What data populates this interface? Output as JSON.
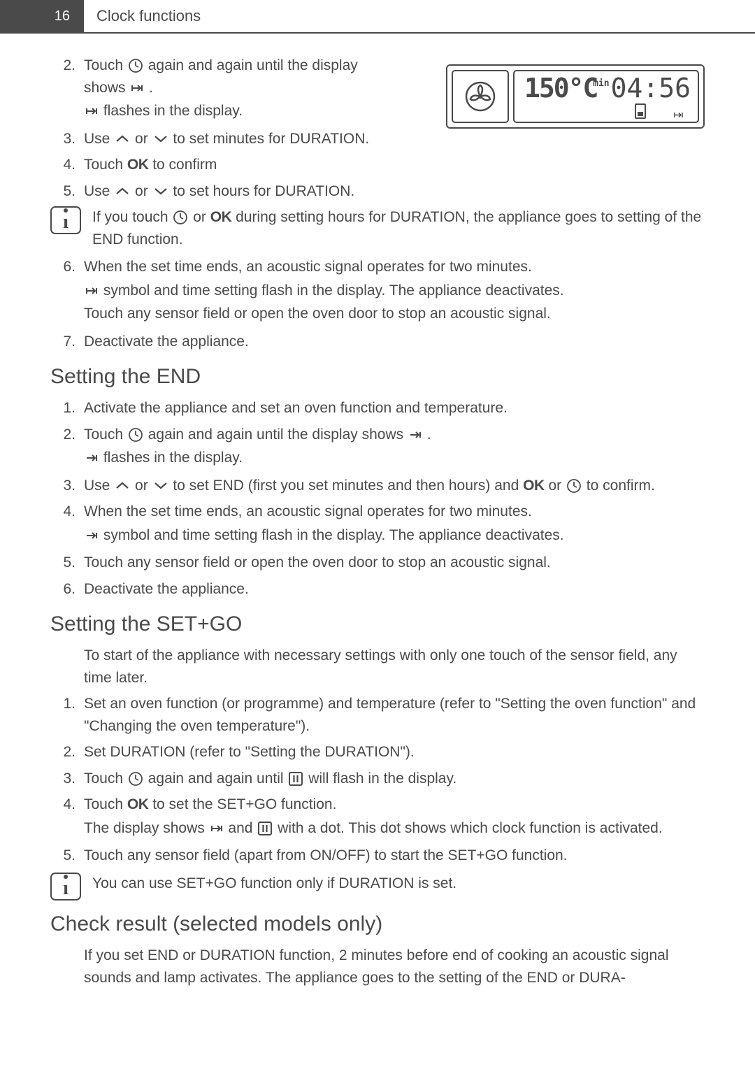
{
  "header": {
    "page_number": "16",
    "title": "Clock functions"
  },
  "display_panel": {
    "temperature": "150°C",
    "min_label": "min",
    "time_value": "04:56"
  },
  "step2": {
    "num": "2.",
    "line1_a": "Touch ",
    "line1_b": " again and again until the display shows ",
    "line1_c": " .",
    "line2_a": "",
    "line2_b": " flashes in the display."
  },
  "step3": {
    "num": "3.",
    "line_a": "Use ",
    "line_b": " or ",
    "line_c": " to set minutes for DURATION."
  },
  "step4": {
    "num": "4.",
    "line_a": "Touch ",
    "ok": "OK",
    "line_b": " to confirm"
  },
  "step5": {
    "num": "5.",
    "line_a": "Use ",
    "line_b": " or ",
    "line_c": " to set hours for DURATION."
  },
  "info1": {
    "line_a": "If you touch ",
    "line_b": " or ",
    "ok": "OK",
    "line_c": " during setting hours for DURATION, the appliance goes to setting of the END function."
  },
  "step6": {
    "num": "6.",
    "line1": "When the set time ends, an acoustic signal operates for two minutes.",
    "line2_a": "",
    "line2_b": " symbol and time setting flash in the display. The appliance deactivates.",
    "line3": "Touch any sensor field or open the oven door to stop an acoustic signal."
  },
  "step7": {
    "num": "7.",
    "text": "Deactivate the appliance."
  },
  "heading_end": "Setting the END",
  "end1": {
    "num": "1.",
    "text": "Activate the appliance and set an oven function and temperature."
  },
  "end2": {
    "num": "2.",
    "line1_a": "Touch ",
    "line1_b": " again and again until the display shows ",
    "line1_c": " .",
    "line2_a": "",
    "line2_b": " flashes in the display."
  },
  "end3": {
    "num": "3.",
    "line_a": "Use ",
    "line_b": " or ",
    "line_c": " to set END (first you set minutes and then hours) and ",
    "ok": "OK",
    "line_d": " or ",
    "line_e": " to confirm."
  },
  "end4": {
    "num": "4.",
    "line1": "When the set time ends, an acoustic signal operates for two minutes.",
    "line2_a": "",
    "line2_b": " symbol and time setting flash in the display. The appliance deactivates."
  },
  "end5": {
    "num": "5.",
    "text": "Touch any sensor field or open the oven door to stop an acoustic signal."
  },
  "end6": {
    "num": "6.",
    "text": "Deactivate the appliance."
  },
  "heading_setgo": "Setting the SET+GO",
  "setgo_intro": "To start of the appliance with necessary settings with only one touch of the sensor field, any time later.",
  "sg1": {
    "num": "1.",
    "text": "Set an oven function (or programme) and temperature (refer to \"Setting the oven function\" and \"Changing the oven temperature\")."
  },
  "sg2": {
    "num": "2.",
    "text": "Set DURATION (refer to \"Setting the DURATION\")."
  },
  "sg3": {
    "num": "3.",
    "line_a": "Touch ",
    "line_b": " again and again until ",
    "line_c": " will flash in the display."
  },
  "sg4": {
    "num": "4.",
    "line1_a": "Touch ",
    "ok": "OK",
    "line1_b": " to set the SET+GO function.",
    "line2_a": "The display shows ",
    "line2_b": " and ",
    "line2_c": " with a dot. This dot shows which clock function is activated."
  },
  "sg5": {
    "num": "5.",
    "text": "Touch any sensor field (apart from ON/OFF) to start the SET+GO function."
  },
  "info2": "You can use SET+GO function only if DURATION is set.",
  "heading_check": "Check result (selected models only)",
  "check_text": "If you set END or DURATION function, 2 minutes before end of cooking an acoustic signal sounds and lamp activates. The appliance goes to the setting of the END or DURA-"
}
